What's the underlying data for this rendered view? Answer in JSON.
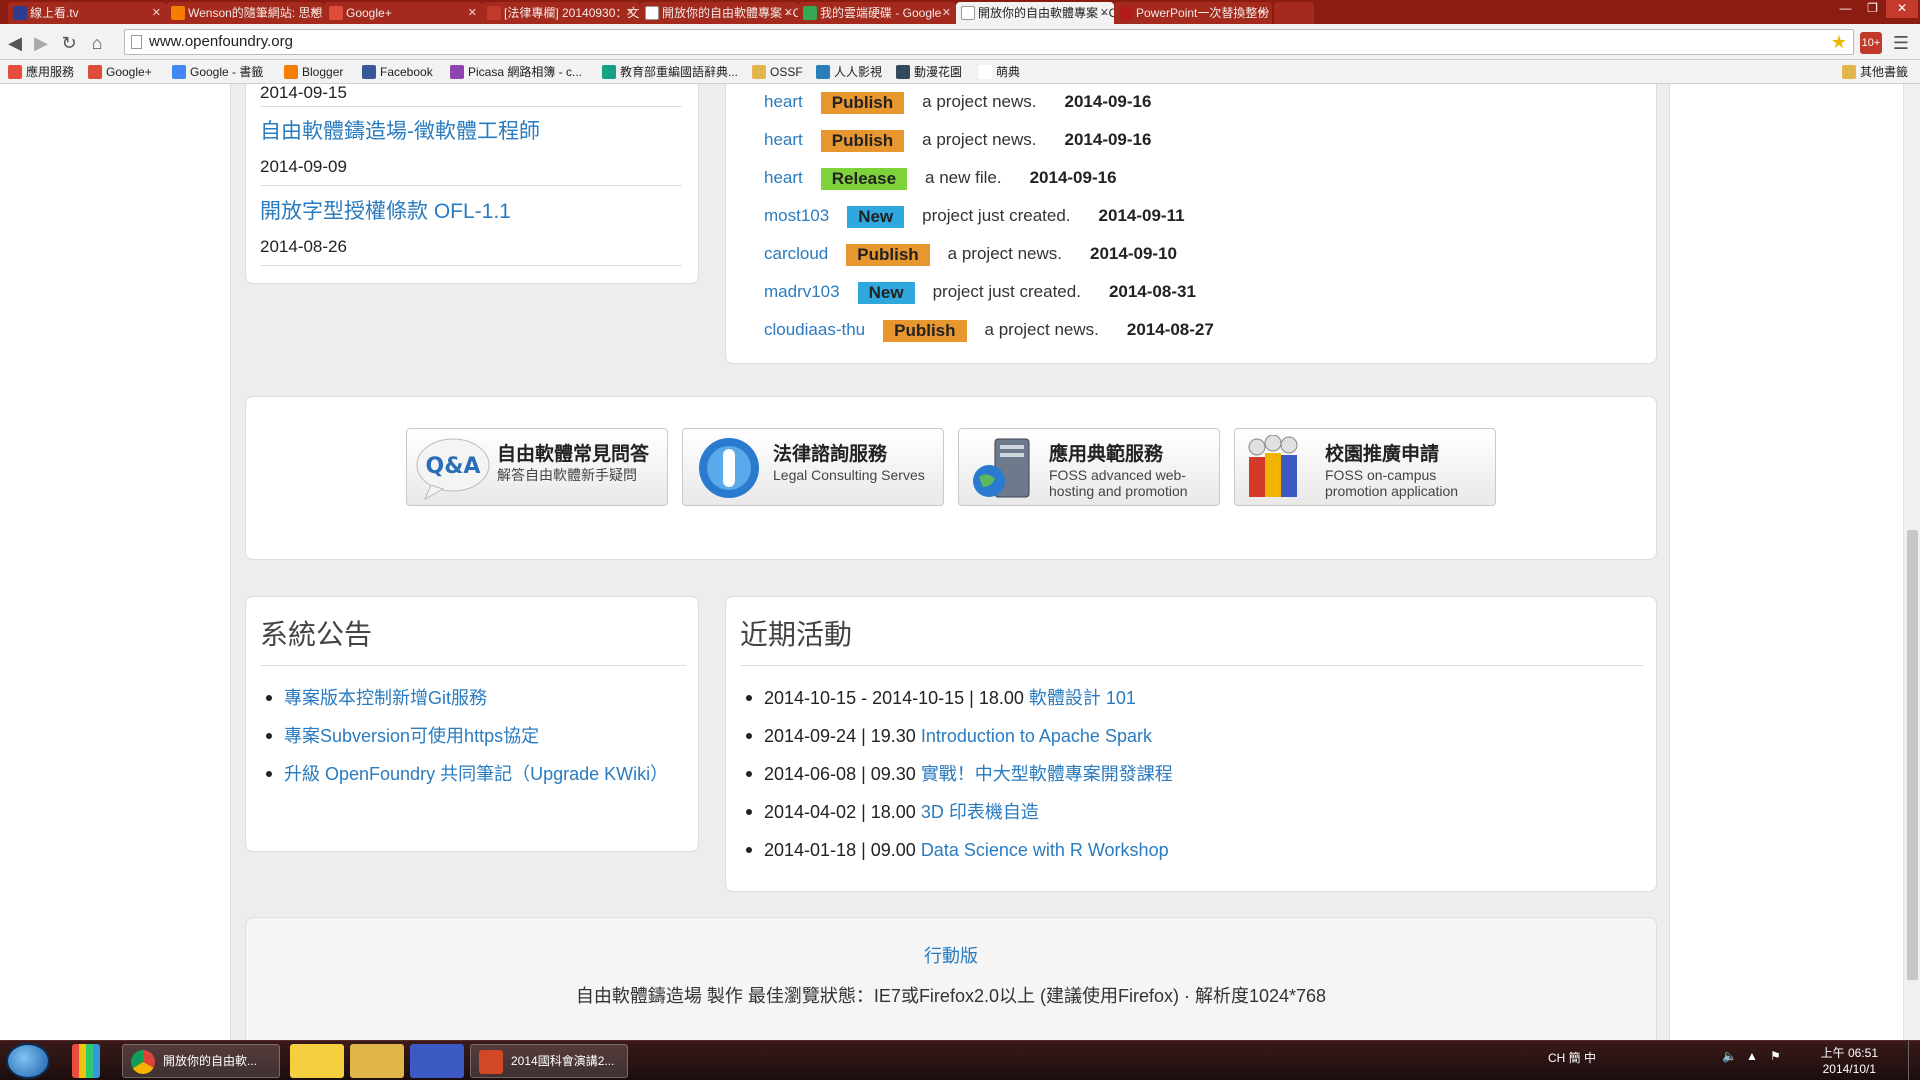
{
  "browser": {
    "tabs": [
      {
        "label": "線上看.tv",
        "color": "#2f3d8f"
      },
      {
        "label": "Wenson的隨筆網站: 思想",
        "color": "#f57d00"
      },
      {
        "label": "Google+",
        "color": "#dd4b39"
      },
      {
        "label": "[法律專欄] 20140930：文",
        "color": "#c0392b"
      },
      {
        "label": "開放你的自由軟體專案 - C",
        "color": "#ffffff"
      },
      {
        "label": "我的雲端硬碟 - Google",
        "color": "#34a853"
      },
      {
        "label": "開放你的自由軟體專案 - C",
        "color": "#ffffff"
      },
      {
        "label": "PowerPoint一次替換整份",
        "color": "#b31b1b"
      }
    ],
    "url": "www.openfoundry.org",
    "bookmarks": [
      {
        "label": "應用服務",
        "color": "#e74c3c"
      },
      {
        "label": "Google+",
        "color": "#dd4b39"
      },
      {
        "label": "Google - 書籤",
        "color": "#4285f4"
      },
      {
        "label": "Blogger",
        "color": "#f57d00"
      },
      {
        "label": "Facebook",
        "color": "#3b5998"
      },
      {
        "label": "Picasa 網路相簿 - c...",
        "color": "#8e44ad"
      },
      {
        "label": "教育部重編國語辭典...",
        "color": "#16a085"
      },
      {
        "label": "OSSF",
        "color": "#e0b64a"
      },
      {
        "label": "人人影視",
        "color": "#2980b9"
      },
      {
        "label": "動漫花園",
        "color": "#34495e"
      },
      {
        "label": "萌典",
        "color": "#ffffff"
      },
      {
        "label": "其他書籤",
        "color": "#e0b64a"
      }
    ]
  },
  "news": {
    "clipped_date": "2014-09-15",
    "items": [
      {
        "title": "自由軟體鑄造場-徵軟體工程師",
        "date": "2014-09-09"
      },
      {
        "title": "開放字型授權條款 OFL-1.1",
        "date": "2014-08-26"
      }
    ]
  },
  "activities": [
    {
      "project": "heart",
      "badge": "Publish",
      "badge_color": "#e8962e",
      "text": "a project news.",
      "date": "2014-09-16"
    },
    {
      "project": "heart",
      "badge": "Publish",
      "badge_color": "#e8962e",
      "text": "a project news.",
      "date": "2014-09-16"
    },
    {
      "project": "heart",
      "badge": "Release",
      "badge_color": "#7fd33a",
      "text": "a new file.",
      "date": "2014-09-16"
    },
    {
      "project": "most103",
      "badge": "New",
      "badge_color": "#2fa8dd",
      "text": "project just created.",
      "date": "2014-09-11"
    },
    {
      "project": "carcloud",
      "badge": "Publish",
      "badge_color": "#e8962e",
      "text": "a project news.",
      "date": "2014-09-10"
    },
    {
      "project": "madrv103",
      "badge": "New",
      "badge_color": "#2fa8dd",
      "text": "project just created.",
      "date": "2014-08-31"
    },
    {
      "project": "cloudiaas-thu",
      "badge": "Publish",
      "badge_color": "#e8962e",
      "text": "a project news.",
      "date": "2014-08-27"
    }
  ],
  "services": [
    {
      "icon": "qa-icon",
      "title": "自由軟體常見問答",
      "subtitle": "解答自由軟體新手疑問"
    },
    {
      "icon": "phone-icon",
      "title": "法律諮詢服務",
      "subtitle": "Legal Consulting Serves"
    },
    {
      "icon": "server-icon",
      "title": "應用典範服務",
      "subtitle": "FOSS advanced web-hosting and promotion"
    },
    {
      "icon": "people-icon",
      "title": "校園推廣申請",
      "subtitle": "FOSS on-campus promotion application"
    }
  ],
  "announcements": {
    "title": "系統公告",
    "items": [
      "專案版本控制新增Git服務",
      "專案Subversion可使用https協定",
      "升級 OpenFoundry 共同筆記（Upgrade KWiki）"
    ]
  },
  "events": {
    "title": "近期活動",
    "items": [
      {
        "when": "2014-10-15 - 2014-10-15 | 18.00",
        "name": "軟體設計 101"
      },
      {
        "when": "2014-09-24 | 19.30",
        "name": "Introduction to Apache Spark"
      },
      {
        "when": "2014-06-08 | 09.30",
        "name": "實戰！中大型軟體專案開發課程"
      },
      {
        "when": "2014-04-02 | 18.00",
        "name": "3D 印表機自造"
      },
      {
        "when": "2014-01-18 | 09.00",
        "name": "Data Science with R Workshop"
      }
    ]
  },
  "footer": {
    "mobile": "行動版",
    "line": "自由軟體鑄造場 製作 最佳瀏覽狀態：IE7或Firefox2.0以上 (建議使用Firefox) · 解析度1024*768"
  },
  "taskbar": {
    "windows": [
      {
        "label": "開放你的自由軟...",
        "color": "#e8b43a"
      },
      {
        "label": "2014國科會演講2...",
        "color": "#d24726"
      }
    ],
    "tray": "CH 簡 中",
    "time": "上午 06:51",
    "date": "2014/10/1"
  }
}
